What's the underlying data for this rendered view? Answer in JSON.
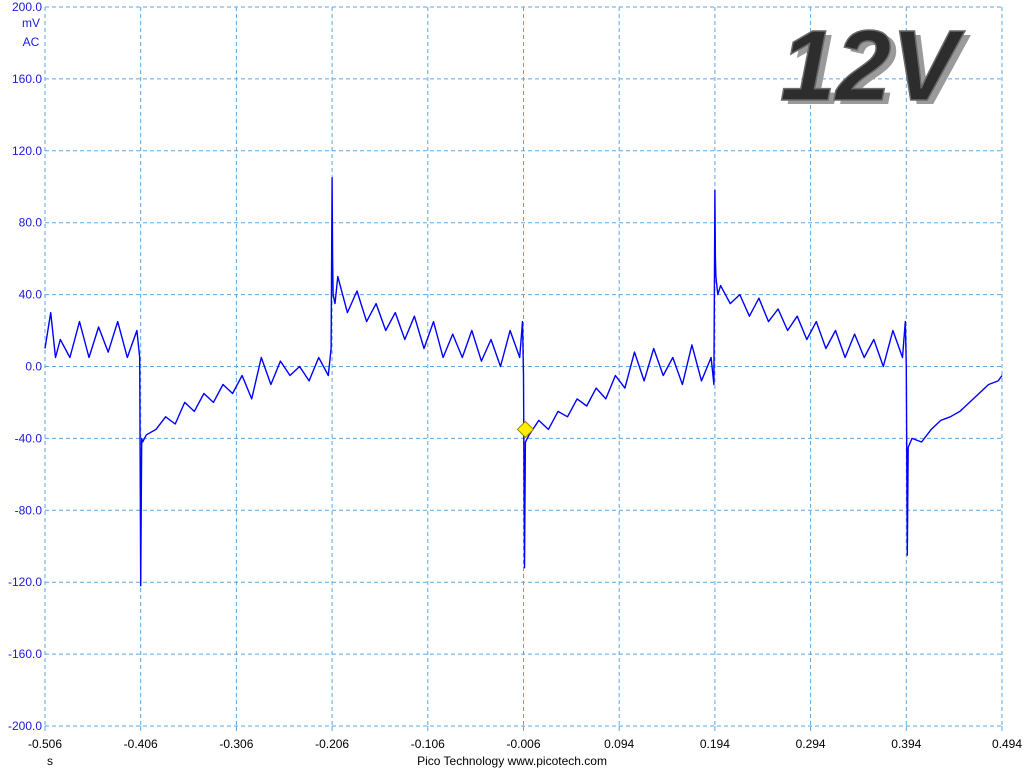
{
  "badge_text": "12V",
  "footer_text": "Pico Technology  www.picotech.com",
  "colors": {
    "trace": "#0000ff",
    "grid": "#5aa8e6",
    "axis_text": "#1a1ae0",
    "trigger": "#ffee00"
  },
  "chart_data": {
    "type": "line",
    "y_unit": "mV",
    "y_coupling": "AC",
    "x_unit": "s",
    "xlim": [
      -0.506,
      0.494
    ],
    "ylim": [
      -200.0,
      200.0
    ],
    "x_ticks": [
      "-0.506",
      "-0.406",
      "-0.306",
      "-0.206",
      "-0.106",
      "-0.006",
      "0.094",
      "0.194",
      "0.294",
      "0.394",
      "0.494"
    ],
    "y_ticks": [
      "200.0",
      "160.0",
      "120.0",
      "80.0",
      "40.0",
      "0.0",
      "-40.0",
      "-80.0",
      "-120.0",
      "-160.0",
      "-200.0"
    ],
    "grid": true,
    "trigger_marker": {
      "x": -0.004,
      "y": -35
    },
    "series": [
      {
        "x": [
          -0.506,
          -0.5,
          -0.495,
          -0.49,
          -0.48,
          -0.47,
          -0.46,
          -0.45,
          -0.44,
          -0.43,
          -0.42,
          -0.41,
          -0.407,
          -0.406,
          -0.405,
          -0.404,
          -0.4,
          -0.39,
          -0.38,
          -0.37,
          -0.36,
          -0.35,
          -0.34,
          -0.33,
          -0.32,
          -0.31,
          -0.3,
          -0.29,
          -0.28,
          -0.27,
          -0.26,
          -0.25,
          -0.24,
          -0.23,
          -0.22,
          -0.21,
          -0.207,
          -0.206,
          -0.2055,
          -0.205,
          -0.203,
          -0.2,
          -0.19,
          -0.18,
          -0.17,
          -0.16,
          -0.15,
          -0.14,
          -0.13,
          -0.12,
          -0.11,
          -0.1,
          -0.09,
          -0.08,
          -0.07,
          -0.06,
          -0.05,
          -0.04,
          -0.03,
          -0.02,
          -0.01,
          -0.007,
          -0.006,
          -0.005,
          -0.004,
          0.0,
          0.01,
          0.02,
          0.03,
          0.04,
          0.05,
          0.06,
          0.07,
          0.08,
          0.09,
          0.1,
          0.11,
          0.12,
          0.13,
          0.14,
          0.15,
          0.16,
          0.17,
          0.18,
          0.19,
          0.193,
          0.194,
          0.1945,
          0.195,
          0.197,
          0.2,
          0.21,
          0.22,
          0.23,
          0.24,
          0.25,
          0.26,
          0.27,
          0.28,
          0.29,
          0.3,
          0.31,
          0.32,
          0.33,
          0.34,
          0.35,
          0.36,
          0.37,
          0.38,
          0.39,
          0.393,
          0.394,
          0.395,
          0.396,
          0.4,
          0.41,
          0.42,
          0.43,
          0.44,
          0.45,
          0.46,
          0.47,
          0.48,
          0.49,
          0.494
        ],
        "y": [
          10,
          30,
          5,
          15,
          5,
          25,
          5,
          22,
          8,
          25,
          5,
          20,
          5,
          -122,
          -40,
          -42,
          -38,
          -35,
          -28,
          -32,
          -20,
          -25,
          -15,
          -20,
          -10,
          -15,
          -5,
          -18,
          5,
          -10,
          3,
          -5,
          0,
          -8,
          5,
          -5,
          10,
          105,
          60,
          40,
          35,
          50,
          30,
          42,
          25,
          35,
          20,
          30,
          15,
          28,
          10,
          25,
          5,
          18,
          5,
          20,
          3,
          15,
          0,
          20,
          5,
          25,
          -5,
          -112,
          -42,
          -38,
          -30,
          -35,
          -25,
          -28,
          -18,
          -22,
          -12,
          -18,
          -5,
          -12,
          8,
          -8,
          10,
          -5,
          5,
          -10,
          12,
          -8,
          5,
          -10,
          98,
          60,
          50,
          40,
          45,
          35,
          40,
          28,
          38,
          25,
          32,
          20,
          28,
          15,
          25,
          10,
          20,
          5,
          18,
          5,
          15,
          0,
          20,
          5,
          25,
          0,
          -105,
          -45,
          -40,
          -42,
          -35,
          -30,
          -28,
          -25,
          -20,
          -15,
          -10,
          -8,
          -5
        ]
      }
    ]
  }
}
